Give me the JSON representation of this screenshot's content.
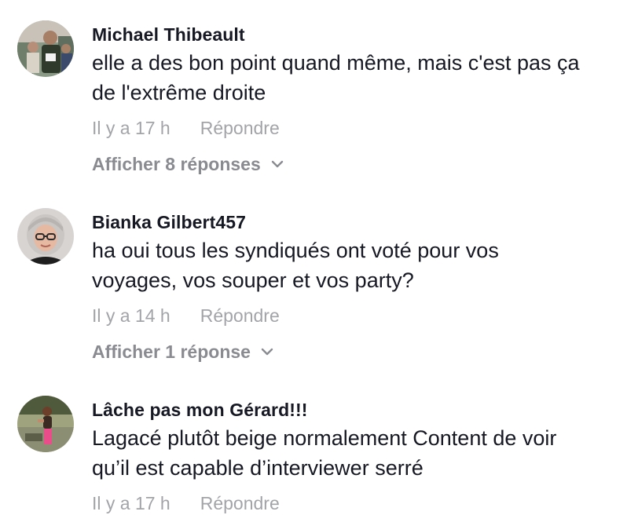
{
  "comments": [
    {
      "username": "Michael Thibeault",
      "text_lines": [
        "elle a des bon point quand même, mais c'est pas ça",
        "de l'extrême droite"
      ],
      "timestamp": "Il y a 17 h",
      "reply_label": "Répondre",
      "view_replies_label": "Afficher 8 réponses",
      "avatar_icon": "avatar-runner-photo"
    },
    {
      "username": "Bianka Gilbert457",
      "text_lines": [
        "ha oui tous les syndiqués ont voté pour vos",
        "voyages, vos souper et vos party?"
      ],
      "timestamp": "Il y a 14 h",
      "reply_label": "Répondre",
      "view_replies_label": "Afficher 1 réponse",
      "avatar_icon": "avatar-woman-glasses-photo"
    },
    {
      "username": "Lâche pas mon Gérard!!!",
      "text_lines": [
        "Lagacé plutôt beige normalement Content de voir",
        "qu’il est capable d’interviewer serré"
      ],
      "timestamp": "Il y a 17 h",
      "reply_label": "Répondre",
      "avatar_icon": "avatar-woman-outdoor-photo"
    }
  ],
  "colors": {
    "username": "#161823",
    "body_text": "#161823",
    "meta_text": "#a3a4a8",
    "view_replies": "#8a8b91"
  }
}
